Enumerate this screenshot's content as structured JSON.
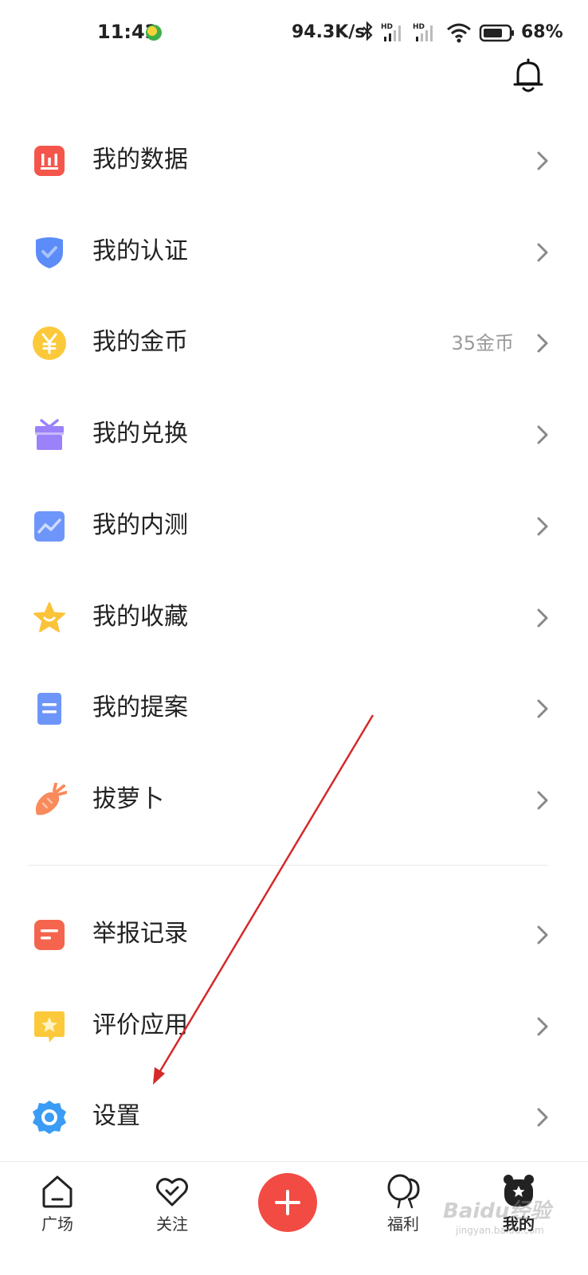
{
  "status_bar": {
    "time": "11:42",
    "network_speed": "94.3K/s",
    "battery_percent": "68%",
    "icons": [
      "bluetooth-icon",
      "hd-signal-icon",
      "hd-signal-icon",
      "wifi-icon",
      "battery-icon"
    ]
  },
  "header": {
    "bell_icon": "bell-icon"
  },
  "menu": {
    "items": [
      {
        "label": "我的数据",
        "icon": "data-chart-icon",
        "color": "#f5564c"
      },
      {
        "label": "我的认证",
        "icon": "shield-check-icon",
        "color": "#5b8cf7"
      },
      {
        "label": "我的金币",
        "icon": "coin-yen-icon",
        "color": "#fbc93a",
        "extra": "35金币"
      },
      {
        "label": "我的兑换",
        "icon": "gift-icon",
        "color": "#9b82fb"
      },
      {
        "label": "我的内测",
        "icon": "trend-chart-icon",
        "color": "#6e96fa"
      },
      {
        "label": "我的收藏",
        "icon": "star-icon",
        "color": "#fbc339"
      },
      {
        "label": "我的提案",
        "icon": "document-icon",
        "color": "#6e96fa"
      },
      {
        "label": "拔萝卜",
        "icon": "carrot-icon",
        "color": "#f88a5c"
      },
      {
        "label": "举报记录",
        "icon": "report-icon",
        "color": "#f5654d"
      },
      {
        "label": "评价应用",
        "icon": "rate-star-bubble-icon",
        "color": "#fbc93a"
      },
      {
        "label": "设置",
        "icon": "gear-icon",
        "color": "#3a9cf4"
      }
    ]
  },
  "bottom_nav": {
    "items": [
      {
        "label": "广场",
        "icon": "home-icon"
      },
      {
        "label": "关注",
        "icon": "heart-check-icon"
      },
      {
        "label": "福利",
        "icon": "balloon-icon"
      },
      {
        "label": "我的",
        "icon": "bear-avatar-icon",
        "active": true
      }
    ],
    "fab": {
      "icon": "plus-icon",
      "color": "#f24b44"
    }
  },
  "watermark": {
    "text": "Baidu经验",
    "sub": "jingyan.baidu.com"
  },
  "annotation": {
    "color": "#d42a2a"
  }
}
